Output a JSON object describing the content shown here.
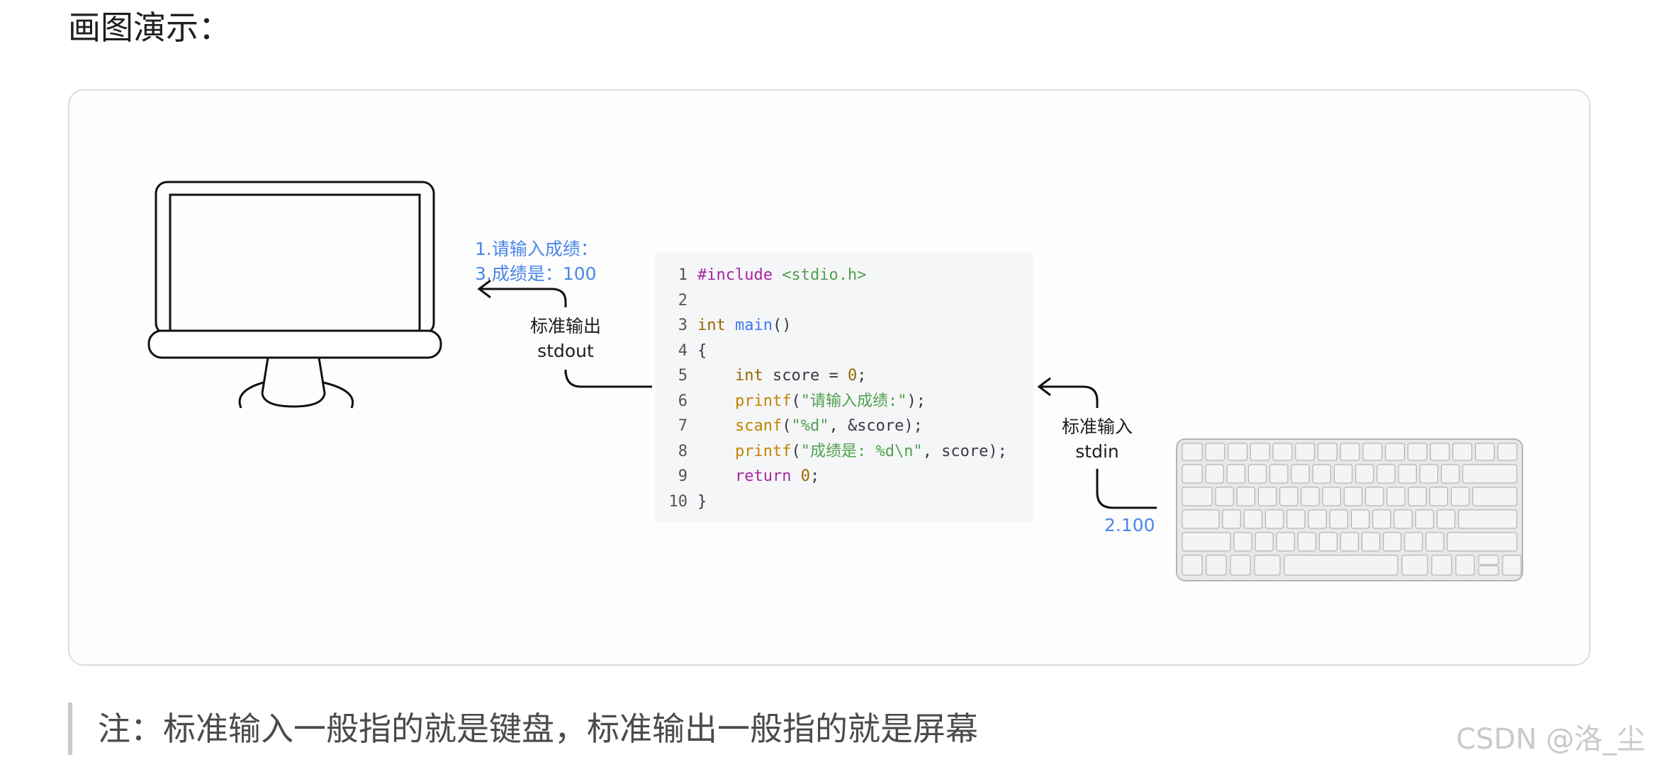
{
  "heading": "画图演示：",
  "labels": {
    "output_prompt_1": "1.请输入成绩：",
    "output_prompt_3": "3.成绩是：100",
    "stdout_cn": "标准输出",
    "stdout_en": "stdout",
    "stdin_cn": "标准输入",
    "stdin_en": "stdin",
    "input_value": "2.100"
  },
  "code": {
    "line_numbers": [
      "1",
      "2",
      "3",
      "4",
      "5",
      "6",
      "7",
      "8",
      "9",
      "10"
    ],
    "l1": {
      "pre": "#include",
      "inc": "<stdio.h>"
    },
    "l3": {
      "kw": "int",
      "fn": "main",
      "rest": "()"
    },
    "l4": "{",
    "l5": {
      "kw": "int",
      "rest": " score = ",
      "num": "0",
      "end": ";"
    },
    "l6": {
      "fn": "printf",
      "open": "(",
      "str": "\"请输入成绩:\"",
      "end": ");"
    },
    "l7": {
      "fn": "scanf",
      "open": "(",
      "str": "\"%d\"",
      "end": ", &score);"
    },
    "l8": {
      "fn": "printf",
      "open": "(",
      "str": "\"成绩是: %d\\n\"",
      "end": ", score);"
    },
    "l9": {
      "kw": "return",
      "num": "0",
      "end": ";"
    },
    "l10": "}"
  },
  "note": "注：标准输入一般指的就是键盘，标准输出一般指的就是屏幕",
  "watermark": "CSDN @洛_尘",
  "colors": {
    "annotation_blue": "#4a86e8",
    "code_bg": "#f5f6f7"
  },
  "icons": [
    "monitor-icon",
    "keyboard-icon",
    "arrow-left-icon"
  ]
}
